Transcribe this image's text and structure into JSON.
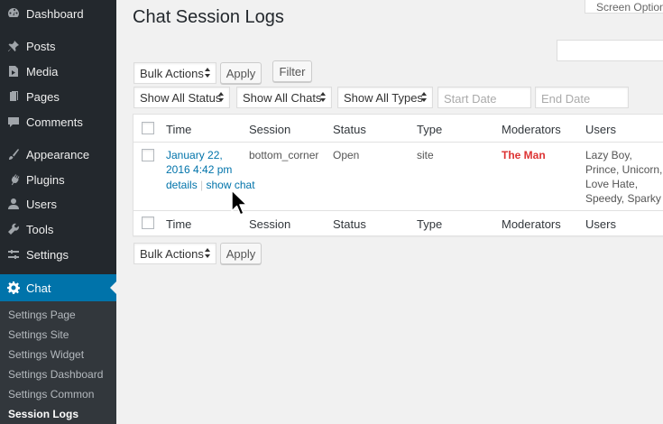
{
  "sidebar": {
    "items": [
      {
        "label": "Dashboard",
        "icon": "dashboard-icon"
      },
      {
        "label": "Posts",
        "icon": "pin-icon"
      },
      {
        "label": "Media",
        "icon": "media-icon"
      },
      {
        "label": "Pages",
        "icon": "pages-icon"
      },
      {
        "label": "Comments",
        "icon": "comment-icon"
      },
      {
        "label": "Appearance",
        "icon": "brush-icon"
      },
      {
        "label": "Plugins",
        "icon": "plug-icon"
      },
      {
        "label": "Users",
        "icon": "user-icon"
      },
      {
        "label": "Tools",
        "icon": "wrench-icon"
      },
      {
        "label": "Settings",
        "icon": "settings-icon"
      },
      {
        "label": "Chat",
        "icon": "gear-icon"
      }
    ],
    "submenu": [
      "Settings Page",
      "Settings Site",
      "Settings Widget",
      "Settings Dashboard",
      "Settings Common",
      "Session Logs"
    ]
  },
  "header": {
    "title": "Chat Session Logs",
    "screen_options": "Screen Options"
  },
  "toolbar": {
    "bulk_actions": "Bulk Actions",
    "apply": "Apply",
    "filter": "Filter",
    "show_status": "Show All Status",
    "show_chats": "Show All Chats",
    "show_types": "Show All Types",
    "start_date_placeholder": "Start Date",
    "end_date_placeholder": "End Date"
  },
  "table": {
    "columns": [
      "Time",
      "Session",
      "Status",
      "Type",
      "Moderators",
      "Users"
    ],
    "rows": [
      {
        "time_line1": "January 22,",
        "time_line2": "2016 4:42 pm",
        "details": "details",
        "separator": "|",
        "show_chat": "show chat",
        "session": "bottom_corner",
        "status": "Open",
        "type": "site",
        "moderators": "The Man",
        "users": [
          "Lazy Boy,",
          "Prince, Unicorn,",
          "Love Hate,",
          "Speedy, Sparky"
        ]
      }
    ]
  },
  "bottom_toolbar": {
    "bulk_actions": "Bulk Actions",
    "apply": "Apply"
  },
  "colors": {
    "sidebar_bg": "#23282d",
    "active_bg": "#0073aa",
    "link": "#0073aa",
    "moderator": "#dd3333"
  }
}
